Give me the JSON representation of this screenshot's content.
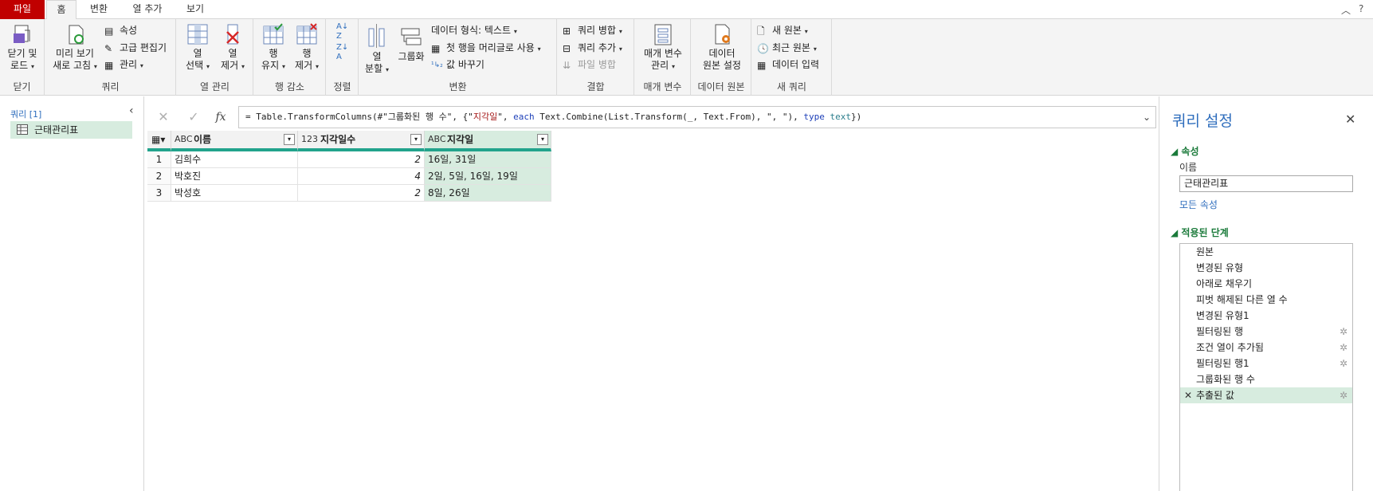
{
  "tabs": [
    "파일",
    "홈",
    "변환",
    "열 추가",
    "보기"
  ],
  "ribbon": {
    "close": {
      "btn": "닫기 및\n로드",
      "label1": "닫기 및",
      "label2": "로드",
      "group": "닫기"
    },
    "query": {
      "preview1": "미리 보기",
      "preview2": "새로 고침",
      "properties": "속성",
      "advanced": "고급 편집기",
      "manage": "관리",
      "group": "쿼리"
    },
    "columns": {
      "choose1": "열",
      "choose2": "선택",
      "remove1": "열",
      "remove2": "제거",
      "group": "열 관리"
    },
    "rows": {
      "keep1": "행",
      "keep2": "유지",
      "remove1": "행",
      "remove2": "제거",
      "group": "행 감소"
    },
    "sort": {
      "group": "정렬"
    },
    "transform": {
      "split1": "열",
      "split2": "분할",
      "groupby": "그룹화",
      "datatype": "데이터 형식: 텍스트",
      "firstrow": "첫 행을 머리글로 사용",
      "replace": "값 바꾸기",
      "group": "변환"
    },
    "combine": {
      "merge": "쿼리 병합",
      "append": "쿼리 추가",
      "files": "파일 병합",
      "group": "결합"
    },
    "params": {
      "btn1": "매개 변수",
      "btn2": "관리",
      "group": "매개 변수"
    },
    "datasource": {
      "btn1": "데이터",
      "btn2": "원본 설정",
      "group": "데이터 원본"
    },
    "newquery": {
      "newsource": "새 원본",
      "recent": "최근 원본",
      "enter": "데이터 입력",
      "group": "새 쿼리"
    }
  },
  "leftpane": {
    "title": "쿼리 [1]",
    "item": "근태관리표"
  },
  "formula": {
    "p1": "= Table.TransformColumns(#\"그룹화된 행 수\", {\"",
    "s1": "지각일",
    "p2": "\", ",
    "k1": "each",
    "p3": " Text.Combine(List.Transform(_, Text.From), \", \"), ",
    "t1": "type",
    "p4": " ",
    "t2": "text",
    "p5": "})"
  },
  "grid": {
    "columns": [
      {
        "type": "ABC",
        "name": "이름"
      },
      {
        "type": "123",
        "name": "지각일수"
      },
      {
        "type": "ABC",
        "name": "지각일"
      }
    ],
    "rows": [
      {
        "n": "1",
        "name": "김희수",
        "count": "2",
        "days": "16일, 31일"
      },
      {
        "n": "2",
        "name": "박호진",
        "count": "4",
        "days": "2일, 5일, 16일, 19일"
      },
      {
        "n": "3",
        "name": "박성호",
        "count": "2",
        "days": "8일, 26일"
      }
    ]
  },
  "rightpane": {
    "title": "쿼리 설정",
    "props_header": "속성",
    "name_label": "이름",
    "name_value": "근태관리표",
    "all_props": "모든 속성",
    "steps_header": "적용된 단계",
    "steps": [
      "원본",
      "변경된 유형",
      "아래로 채우기",
      "피벗 해제된 다른 열 수",
      "변경된 유형1",
      "필터링된 행",
      "조건 열이 추가됨",
      "필터링된 행1",
      "그룹화된 행 수",
      "추출된 값"
    ]
  }
}
